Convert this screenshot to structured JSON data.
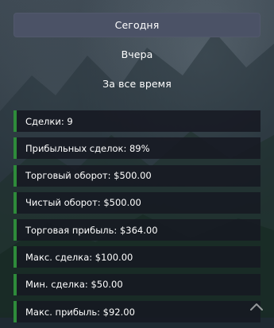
{
  "tabs": [
    {
      "label": "Сегодня",
      "active": true
    },
    {
      "label": "Вчера",
      "active": false
    },
    {
      "label": "За все время",
      "active": false
    }
  ],
  "stats": [
    "Сделки: 9",
    "Прибыльных сделок: 89%",
    "Торговый оборот: $500.00",
    "Чистый оборот: $500.00",
    "Торговая прибыль: $364.00",
    "Макс. сделка: $100.00",
    "Мин. сделка: $50.00",
    "Макс. прибыль: $92.00"
  ],
  "colors": {
    "accent": "#2e8b3a",
    "active_tab": "#4b5266",
    "stat_bg": "#16182a"
  },
  "icons": {
    "scroll_top": "chevron-up-icon"
  }
}
